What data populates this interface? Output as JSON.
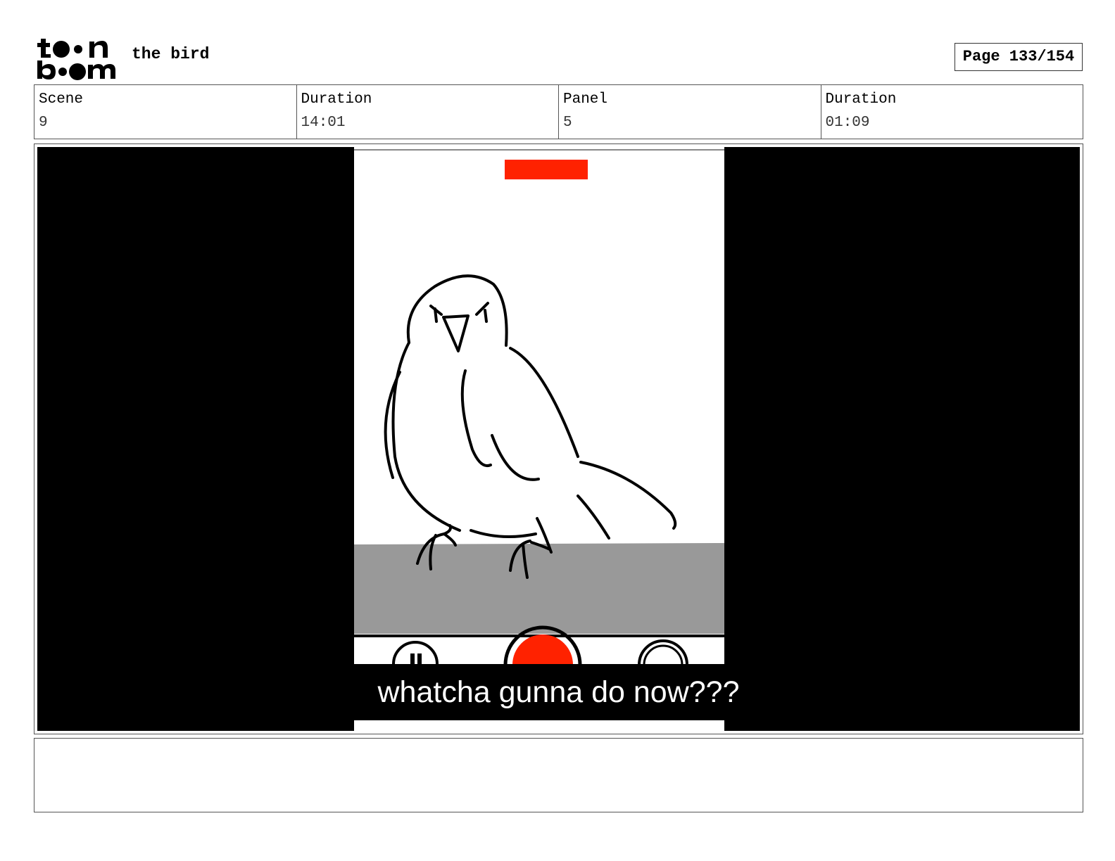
{
  "header": {
    "logo_text": "toonboom",
    "title": "the bird",
    "page_label": "Page 133/154"
  },
  "info": [
    {
      "label": "Scene",
      "value": "9"
    },
    {
      "label": "Duration",
      "value": "14:01"
    },
    {
      "label": "Panel",
      "value": "5"
    },
    {
      "label": "Duration",
      "value": "01:09"
    }
  ],
  "panel": {
    "caption": "whatcha gunna do now???",
    "icons": [
      "recording-indicator-icon",
      "gallery-icon",
      "record-button-icon",
      "switch-camera-icon"
    ],
    "colors": {
      "record_red": "#ff2200",
      "ledge_gray": "#999999",
      "letterbox": "#000000"
    }
  },
  "notes": {
    "text": ""
  }
}
